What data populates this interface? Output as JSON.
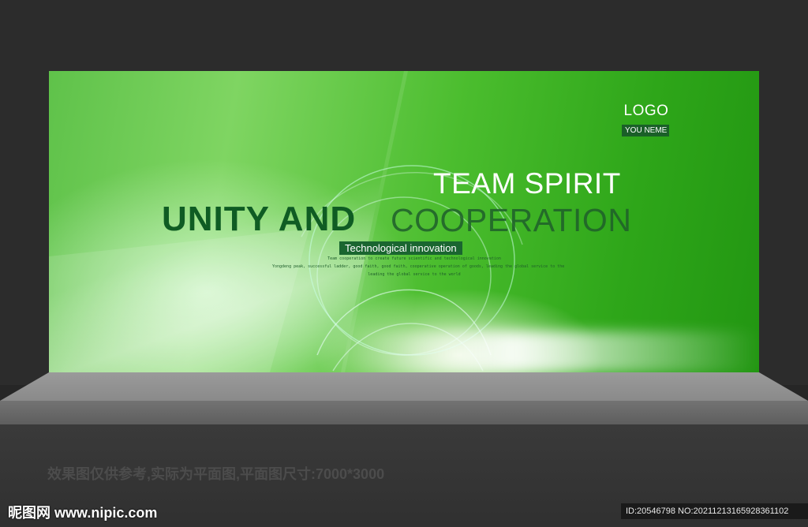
{
  "board": {
    "logo": "LOGO",
    "logo_sub": "YOU NEME",
    "headline_top": "TEAM SPIRIT",
    "headline_bold": "UNITY AND",
    "headline_light": "COOPERATION",
    "tag": "Technological innovation",
    "desc_lines": [
      "Team cooperation to create future scientific and technological innovation",
      "Yongdeng peak, successful ladder, good faith, good faith, cooperative operation of goods, leading the global service to the",
      "leading the global service to the world"
    ],
    "colors": {
      "green_dark": "#0f5c23",
      "green_bright": "#4bbd2e",
      "tag_bg": "#1a6630"
    }
  },
  "caption": "效果图仅供参考,实际为平面图,平面图尺寸:7000*3000",
  "watermark": {
    "site": "昵图网 www.nipic.com",
    "id_text": "ID:20546798 NO:20211213165928361102"
  }
}
